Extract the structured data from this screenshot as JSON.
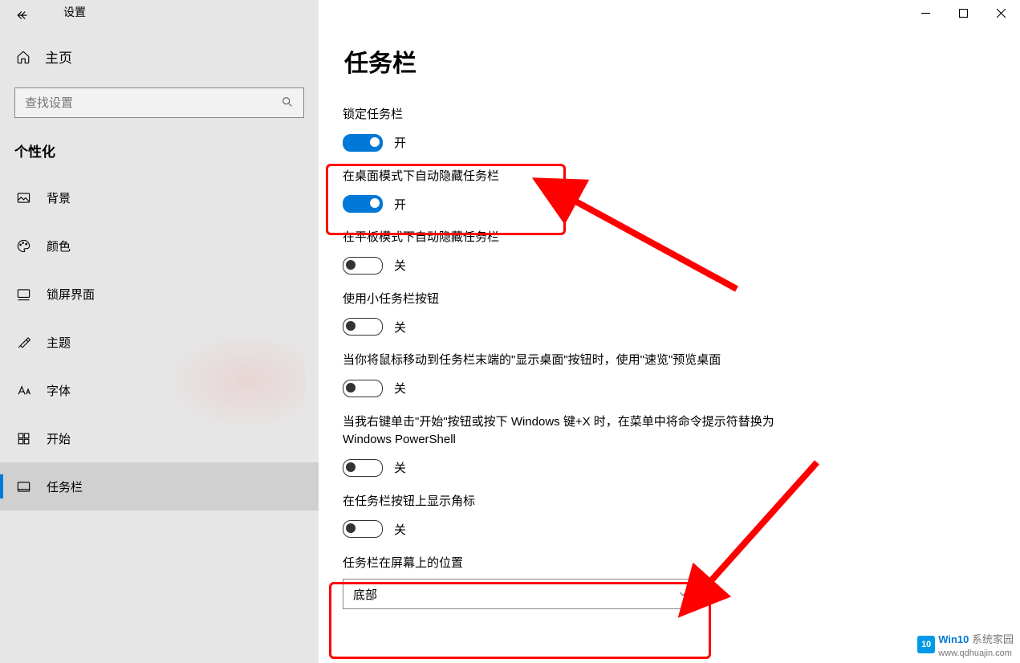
{
  "window": {
    "title": "设置"
  },
  "sidebar": {
    "home": "主页",
    "search_placeholder": "查找设置",
    "section": "个性化",
    "items": [
      {
        "icon": "image",
        "label": "背景"
      },
      {
        "icon": "palette",
        "label": "颜色"
      },
      {
        "icon": "lock",
        "label": "锁屏界面"
      },
      {
        "icon": "theme",
        "label": "主题"
      },
      {
        "icon": "font",
        "label": "字体"
      },
      {
        "icon": "start",
        "label": "开始"
      },
      {
        "icon": "taskbar",
        "label": "任务栏"
      }
    ]
  },
  "page": {
    "title": "任务栏",
    "state_on": "开",
    "state_off": "关",
    "settings": [
      {
        "label": "锁定任务栏",
        "on": true
      },
      {
        "label": "在桌面模式下自动隐藏任务栏",
        "on": true
      },
      {
        "label": "在平板模式下自动隐藏任务栏",
        "on": false
      },
      {
        "label": "使用小任务栏按钮",
        "on": false
      },
      {
        "label": "当你将鼠标移动到任务栏末端的\"显示桌面\"按钮时，使用\"速览\"预览桌面",
        "on": false
      },
      {
        "label": "当我右键单击\"开始\"按钮或按下 Windows 键+X 时，在菜单中将命令提示符替换为 Windows PowerShell",
        "on": false
      },
      {
        "label": "在任务栏按钮上显示角标",
        "on": false
      }
    ],
    "position_label": "任务栏在屏幕上的位置",
    "position_value": "底部"
  },
  "watermark": {
    "brand": "Win10",
    "text": "系统家园",
    "url": "www.qdhuajin.com"
  }
}
